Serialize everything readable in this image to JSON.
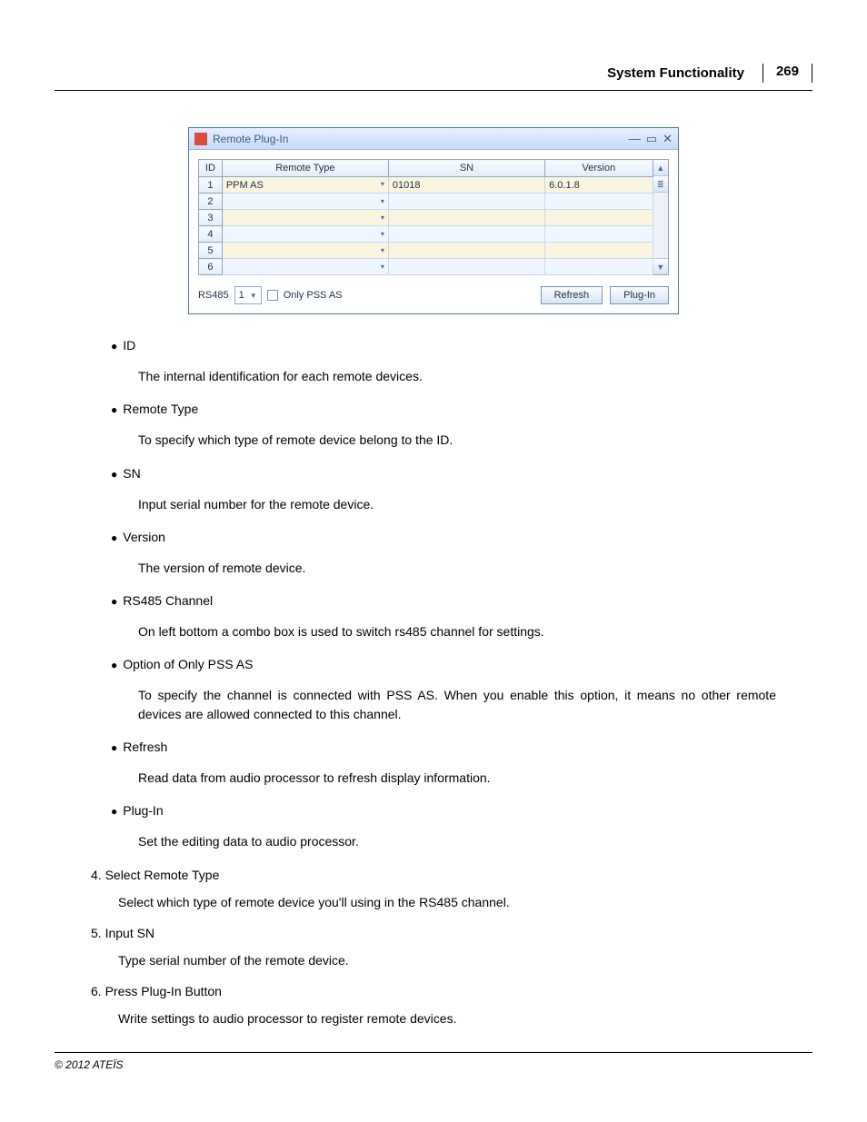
{
  "header": {
    "title": "System Functionality",
    "page": "269"
  },
  "window": {
    "title": "Remote Plug-In",
    "columns": {
      "id": "ID",
      "remote": "Remote Type",
      "sn": "SN",
      "version": "Version"
    },
    "rows": [
      {
        "id": "1",
        "remote": "PPM AS",
        "sn": "01018",
        "version": "6.0.1.8"
      },
      {
        "id": "2",
        "remote": "",
        "sn": "",
        "version": ""
      },
      {
        "id": "3",
        "remote": "",
        "sn": "",
        "version": ""
      },
      {
        "id": "4",
        "remote": "",
        "sn": "",
        "version": ""
      },
      {
        "id": "5",
        "remote": "",
        "sn": "",
        "version": ""
      },
      {
        "id": "6",
        "remote": "",
        "sn": "",
        "version": ""
      }
    ],
    "footer": {
      "rs485_label": "RS485",
      "rs485_value": "1",
      "only_pss_label": "Only PSS AS",
      "refresh": "Refresh",
      "plugin": "Plug-In"
    }
  },
  "bullets": [
    {
      "head": "ID",
      "desc": "The internal identification for each remote devices."
    },
    {
      "head": "Remote Type",
      "desc": "To specify which type of remote device belong to the ID."
    },
    {
      "head": "SN",
      "desc": "Input serial number for the remote device."
    },
    {
      "head": "Version",
      "desc": "The version of remote device."
    },
    {
      "head": "RS485 Channel",
      "desc": "On left bottom a combo box is used to switch rs485 channel for settings."
    },
    {
      "head": "Option of Only PSS AS",
      "desc": "To specify the channel is connected with PSS AS. When you enable this option, it means no other remote devices are allowed connected to this channel."
    },
    {
      "head": "Refresh",
      "desc": "Read data from audio processor to refresh display information."
    },
    {
      "head": "Plug-In",
      "desc": "Set the editing data to audio processor."
    }
  ],
  "numbered": [
    {
      "num": "4.",
      "head": "Select Remote Type",
      "desc": "Select which type of remote device you'll using in the RS485 channel."
    },
    {
      "num": "5.",
      "head": "Input SN",
      "desc": "Type serial number of the remote device."
    },
    {
      "num": "6.",
      "head": "Press Plug-In Button",
      "desc": "Write settings to audio processor to register remote devices."
    }
  ],
  "copyright": "© 2012 ATEÏS"
}
